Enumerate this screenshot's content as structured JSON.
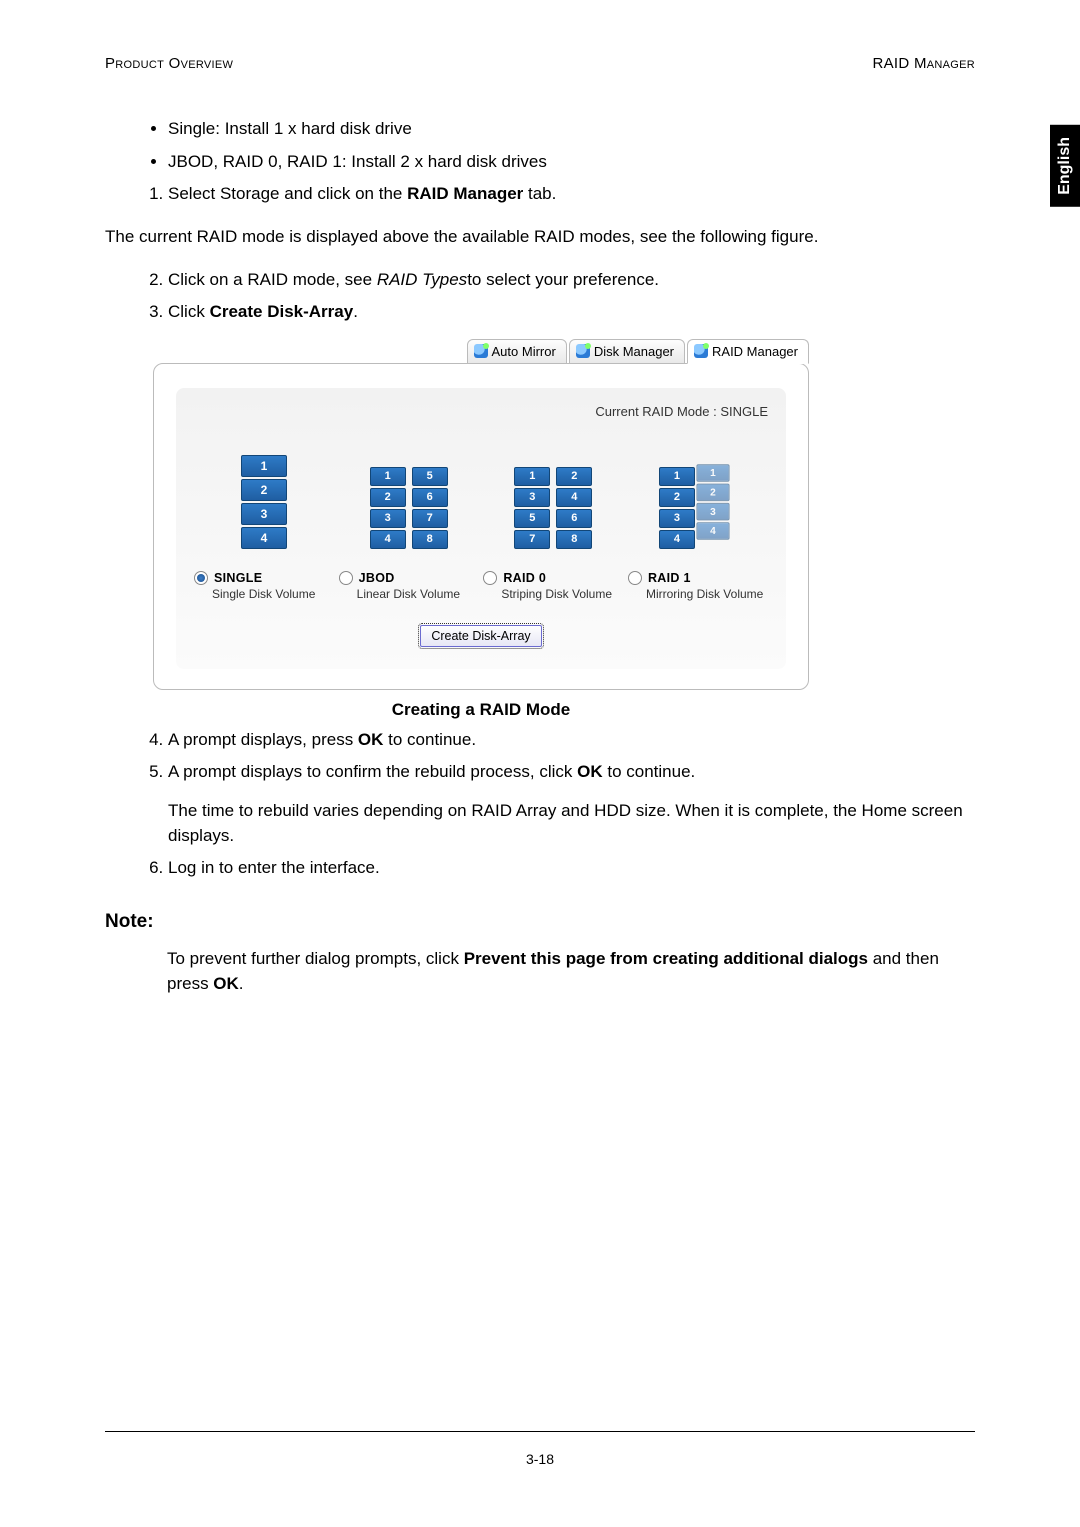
{
  "header": {
    "left": "Product Overview",
    "right": "RAID Manager"
  },
  "side_tab": "English",
  "bullets": [
    "Single: Install 1 x hard disk drive",
    "JBOD, RAID 0, RAID 1: Install 2 x hard disk drives"
  ],
  "step1": {
    "prefix": "Select Storage and click on the ",
    "bold": "RAID Manager",
    "suffix": " tab."
  },
  "paragraph_mode": "The current RAID mode is displayed above the available RAID modes, see the following figure.",
  "step2": {
    "prefix": "Click on a RAID mode, see ",
    "italic": "RAID Types",
    "suffix": "to select your preference."
  },
  "step3": {
    "prefix": "Click ",
    "bold": "Create Disk-Array",
    "suffix": "."
  },
  "figure": {
    "tabs": [
      "Auto Mirror",
      "Disk Manager",
      "RAID Manager"
    ],
    "current_mode": "Current RAID Mode : SINGLE",
    "options": [
      {
        "key": "single",
        "title": "SINGLE",
        "sub": "Single Disk Volume",
        "checked": true,
        "cols": [
          [
            "1",
            "2",
            "3",
            "4"
          ]
        ]
      },
      {
        "key": "jbod",
        "title": "JBOD",
        "sub": "Linear Disk Volume",
        "checked": false,
        "cols": [
          [
            "1",
            "2",
            "3",
            "4"
          ],
          [
            "5",
            "6",
            "7",
            "8"
          ]
        ]
      },
      {
        "key": "raid0",
        "title": "RAID 0",
        "sub": "Striping Disk Volume",
        "checked": false,
        "cols": [
          [
            "1",
            "3",
            "5",
            "7"
          ],
          [
            "2",
            "4",
            "6",
            "8"
          ]
        ]
      },
      {
        "key": "raid1",
        "title": "RAID 1",
        "sub": "Mirroring Disk Volume",
        "checked": false,
        "cols": [
          [
            "1",
            "2",
            "3",
            "4"
          ]
        ],
        "ghost": [
          "1",
          "2",
          "3",
          "4"
        ]
      }
    ],
    "button": "Create Disk-Array",
    "caption": "Creating a RAID Mode"
  },
  "step4": {
    "prefix": "A prompt displays, press ",
    "bold": "OK",
    "suffix": " to continue."
  },
  "step5": {
    "prefix": "A prompt displays to confirm the rebuild process, click ",
    "bold": "OK",
    "suffix": " to continue."
  },
  "step5_note": "The time to rebuild varies depending on RAID Array and HDD size. When it is complete, the Home screen displays.",
  "step6": "Log in to enter the interface.",
  "note_head": "Note:",
  "note_body": {
    "prefix": "To prevent further dialog prompts, click ",
    "bold1": "Prevent this page from creating additional dialogs",
    "mid": " and then press ",
    "bold2": "OK",
    "suffix": "."
  },
  "page_number": "3-18"
}
